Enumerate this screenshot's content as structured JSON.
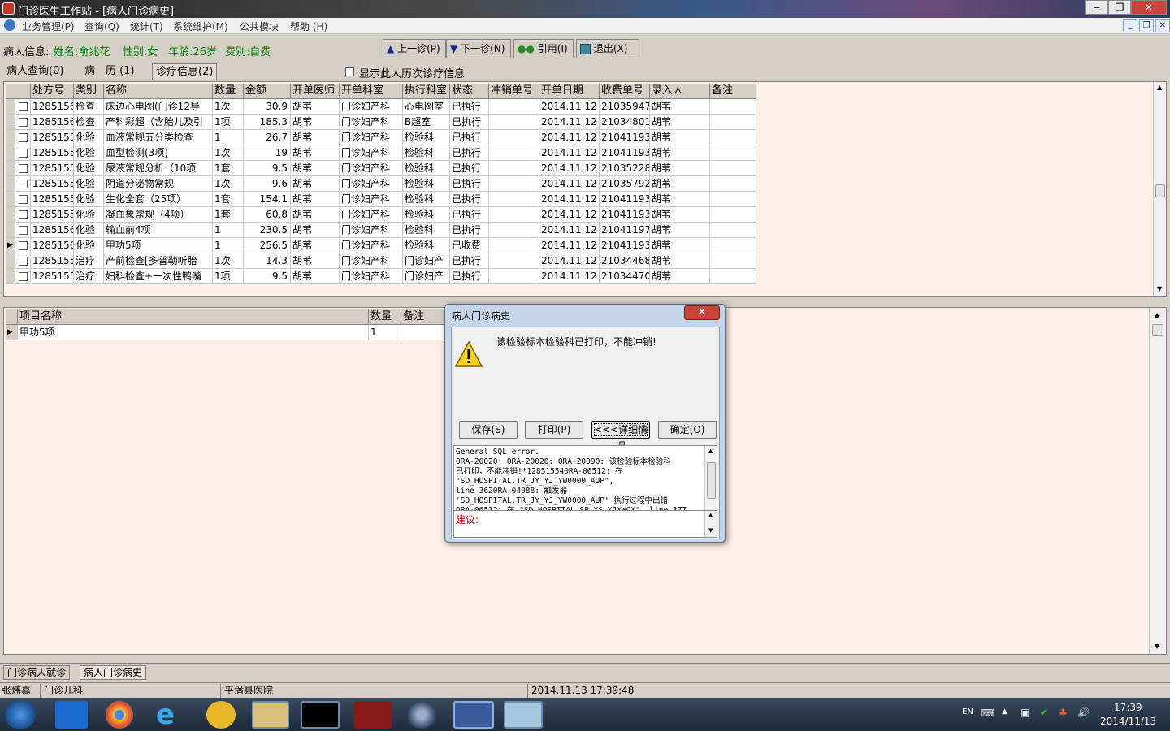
{
  "window": {
    "title": "门诊医生工作站 - [病人门诊病史]"
  },
  "menu": [
    "业务管理(P)",
    "查询(Q)",
    "统计(T)",
    "系统维护(M)",
    "公共模块",
    "帮助 (H)"
  ],
  "patient": {
    "label": "病人信息:",
    "name": "姓名:俞兆花",
    "sex": "性别:女",
    "age": "年龄:26岁",
    "fee": "费别:自费"
  },
  "toolbar": {
    "prev": "上一诊(P)",
    "next": "下一诊(N)",
    "cite": "引用(I)",
    "exit": "退出(X)"
  },
  "tabs": [
    "病人查询(0)",
    "病　历 (1)",
    "诊疗信息(2)"
  ],
  "history_checkbox": "显示此人历次诊疗信息",
  "grid1": {
    "headers": [
      "处方号",
      "类别",
      "名称",
      "数量",
      "金额",
      "开单医师",
      "开单科室",
      "执行科室",
      "状态",
      "冲销单号",
      "开单日期",
      "收费单号",
      "录入人",
      "备注"
    ],
    "rows": [
      [
        "1285156",
        "检查",
        "床边心电图(门诊12导",
        "1次",
        "30.9",
        "胡苇",
        "门诊妇产科",
        "心电图室",
        "已执行",
        "",
        "2014.11.12",
        "21035947",
        "胡苇"
      ],
      [
        "1285156",
        "检查",
        "产科彩超（含胎儿及引",
        "1项",
        "185.3",
        "胡苇",
        "门诊妇产科",
        "B超室",
        "已执行",
        "",
        "2014.11.12",
        "21034801",
        "胡苇"
      ],
      [
        "1285155",
        "化验",
        "血液常规五分类检查",
        "1",
        "26.7",
        "胡苇",
        "门诊妇产科",
        "检验科",
        "已执行",
        "",
        "2014.11.12",
        "21041193",
        "胡苇"
      ],
      [
        "1285155",
        "化验",
        "血型检测(3项)",
        "1次",
        "19",
        "胡苇",
        "门诊妇产科",
        "检验科",
        "已执行",
        "",
        "2014.11.12",
        "21041193",
        "胡苇"
      ],
      [
        "1285155",
        "化验",
        "尿液常规分析（10项",
        "1套",
        "9.5",
        "胡苇",
        "门诊妇产科",
        "检验科",
        "已执行",
        "",
        "2014.11.12",
        "21035228",
        "胡苇"
      ],
      [
        "1285155",
        "化验",
        "阴道分泌物常规",
        "1次",
        "9.6",
        "胡苇",
        "门诊妇产科",
        "检验科",
        "已执行",
        "",
        "2014.11.12",
        "21035792",
        "胡苇"
      ],
      [
        "1285155",
        "化验",
        "生化全套（25项）",
        "1套",
        "154.1",
        "胡苇",
        "门诊妇产科",
        "检验科",
        "已执行",
        "",
        "2014.11.12",
        "21041193",
        "胡苇"
      ],
      [
        "1285155",
        "化验",
        "凝血象常规（4项）",
        "1套",
        "60.8",
        "胡苇",
        "门诊妇产科",
        "检验科",
        "已执行",
        "",
        "2014.11.12",
        "21041193",
        "胡苇"
      ],
      [
        "1285156",
        "化验",
        "输血前4项",
        "1",
        "230.5",
        "胡苇",
        "门诊妇产科",
        "检验科",
        "已执行",
        "",
        "2014.11.12",
        "21041197",
        "胡苇"
      ],
      [
        "1285156",
        "化验",
        "甲功5项",
        "1",
        "256.5",
        "胡苇",
        "门诊妇产科",
        "检验科",
        "已收费",
        "",
        "2014.11.12",
        "21041193",
        "胡苇"
      ],
      [
        "1285155",
        "治疗",
        "产前检查[多普勒听胎",
        "1次",
        "14.3",
        "胡苇",
        "门诊妇产科",
        "门诊妇产",
        "已执行",
        "",
        "2014.11.12",
        "21034468",
        "胡苇"
      ],
      [
        "1285155",
        "治疗",
        "妇科检查+一次性鸭嘴",
        "1项",
        "9.5",
        "胡苇",
        "门诊妇产科",
        "门诊妇产",
        "已执行",
        "",
        "2014.11.12",
        "21034470",
        "胡苇"
      ]
    ]
  },
  "grid2": {
    "headers": [
      "项目名称",
      "数量",
      "备注"
    ],
    "rows": [
      [
        "甲功5项",
        "1",
        ""
      ]
    ]
  },
  "dialog": {
    "title": "病人门诊病史",
    "message": "该检验标本检验科已打印，不能冲销!",
    "buttons": {
      "save": "保存(S)",
      "print": "打印(P)",
      "detail": "<<<详细情况",
      "ok": "确定(O)"
    },
    "detail_lines": [
      "General SQL error.",
      "ORA-20020: ORA-20020: ORA-20090: 该检验标本检验科",
      "已打印，不能冲销!*128515540RA-06512: 在",
      "\"SD_HOSPITAL.TR_JY_YJ_YW0000_AUP\",",
      "line 3620RA-04088: 触发器",
      "'SD_HOSPITAL.TR_JY_YJ_YW0000_AUP' 执行过程中出错",
      "ORA-06512: 在 \"SD_HOSPITAL.SP_YS_YJYWCX\", line 377"
    ],
    "suggest_label": "建议:"
  },
  "bottom_tabs": [
    "门诊病人就诊",
    "病人门诊病史"
  ],
  "status": {
    "user": "张炜嘉",
    "dept": "门诊儿科",
    "hospital": "平潘县医院",
    "datetime": "2014.11.13 17:39:48"
  },
  "tray": {
    "lang": "EN",
    "time": "17:39",
    "date": "2014/11/13"
  }
}
